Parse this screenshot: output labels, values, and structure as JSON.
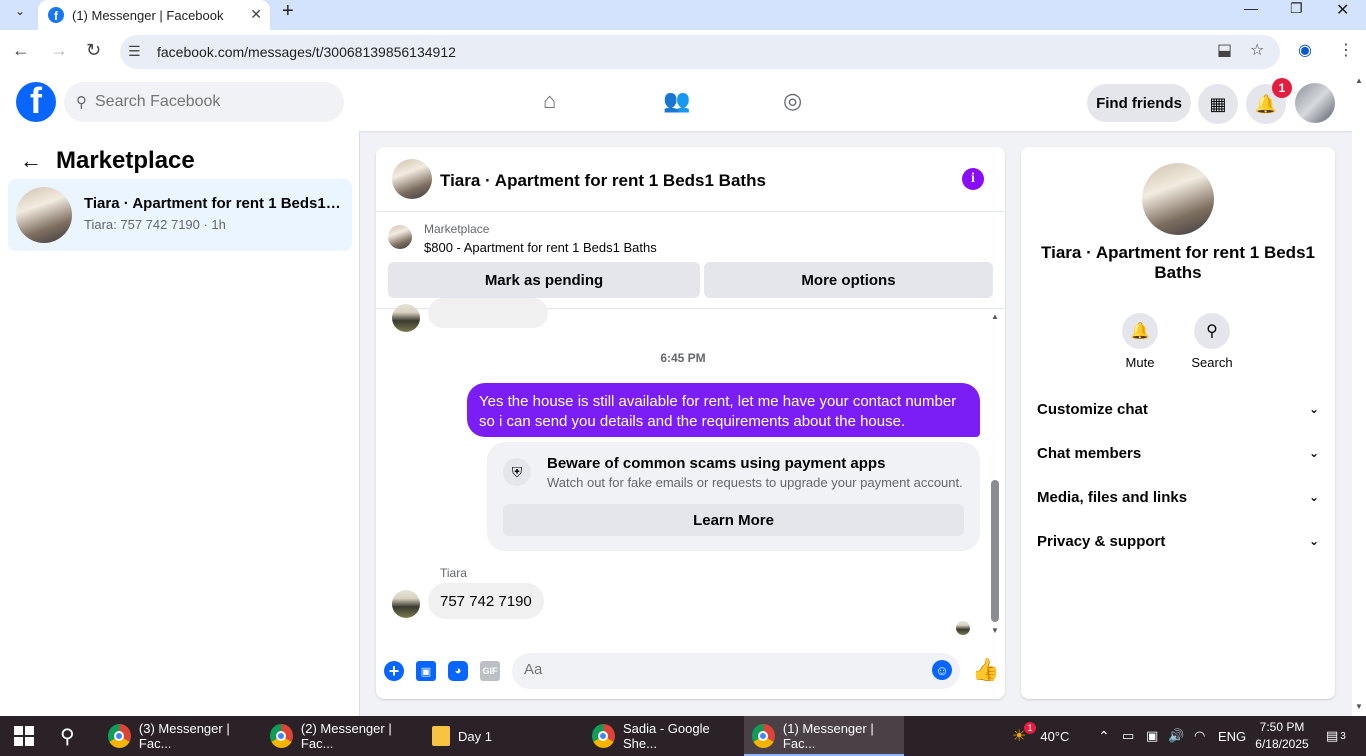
{
  "browser": {
    "tab_title": "(1) Messenger | Facebook",
    "url": "facebook.com/messages/t/30068139856134912"
  },
  "header": {
    "search_placeholder": "Search Facebook",
    "find_friends": "Find friends",
    "notification_count": "1"
  },
  "left_panel": {
    "title": "Marketplace",
    "conversations": [
      {
        "name": "Tiara · Apartment for rent 1 Beds1 Baths",
        "meta": "Tiara: 757 742 7190 · 1h"
      }
    ]
  },
  "chat": {
    "title": "Tiara · Apartment for rent 1 Beds1 Baths",
    "marketplace_label": "Marketplace",
    "listing": "$800 - Apartment for rent 1 Beds1 Baths",
    "mark_pending": "Mark as pending",
    "more_options": "More options",
    "timestamp": "6:45 PM",
    "outgoing_message": "Yes the house is still available for rent, let me have your contact number so i can send you details and the requirements about the house.",
    "scam_title": "Beware of common scams using payment apps",
    "scam_desc": "Watch out for fake emails or requests to upgrade your payment account.",
    "learn_more": "Learn More",
    "sender_name": "Tiara",
    "incoming_message": "757 742 7190",
    "input_placeholder": "Aa"
  },
  "right_panel": {
    "title": "Tiara · Apartment for rent 1 Beds1 Baths",
    "mute": "Mute",
    "search": "Search",
    "sections": [
      "Customize chat",
      "Chat members",
      "Media, files and links",
      "Privacy & support"
    ]
  },
  "taskbar": {
    "items": [
      "(3) Messenger | Fac...",
      "(2) Messenger | Fac...",
      "Day 1",
      "Sadia - Google She...",
      "(1) Messenger | Fac..."
    ],
    "temperature": "40°C",
    "language": "ENG",
    "time": "7:50 PM",
    "date": "6/18/2025",
    "weather_badge": "1",
    "notif_count": "3"
  },
  "colors": {
    "fb_blue": "#0866ff",
    "messenger_purple": "#7b1ef5",
    "badge_red": "#e41e3f"
  }
}
